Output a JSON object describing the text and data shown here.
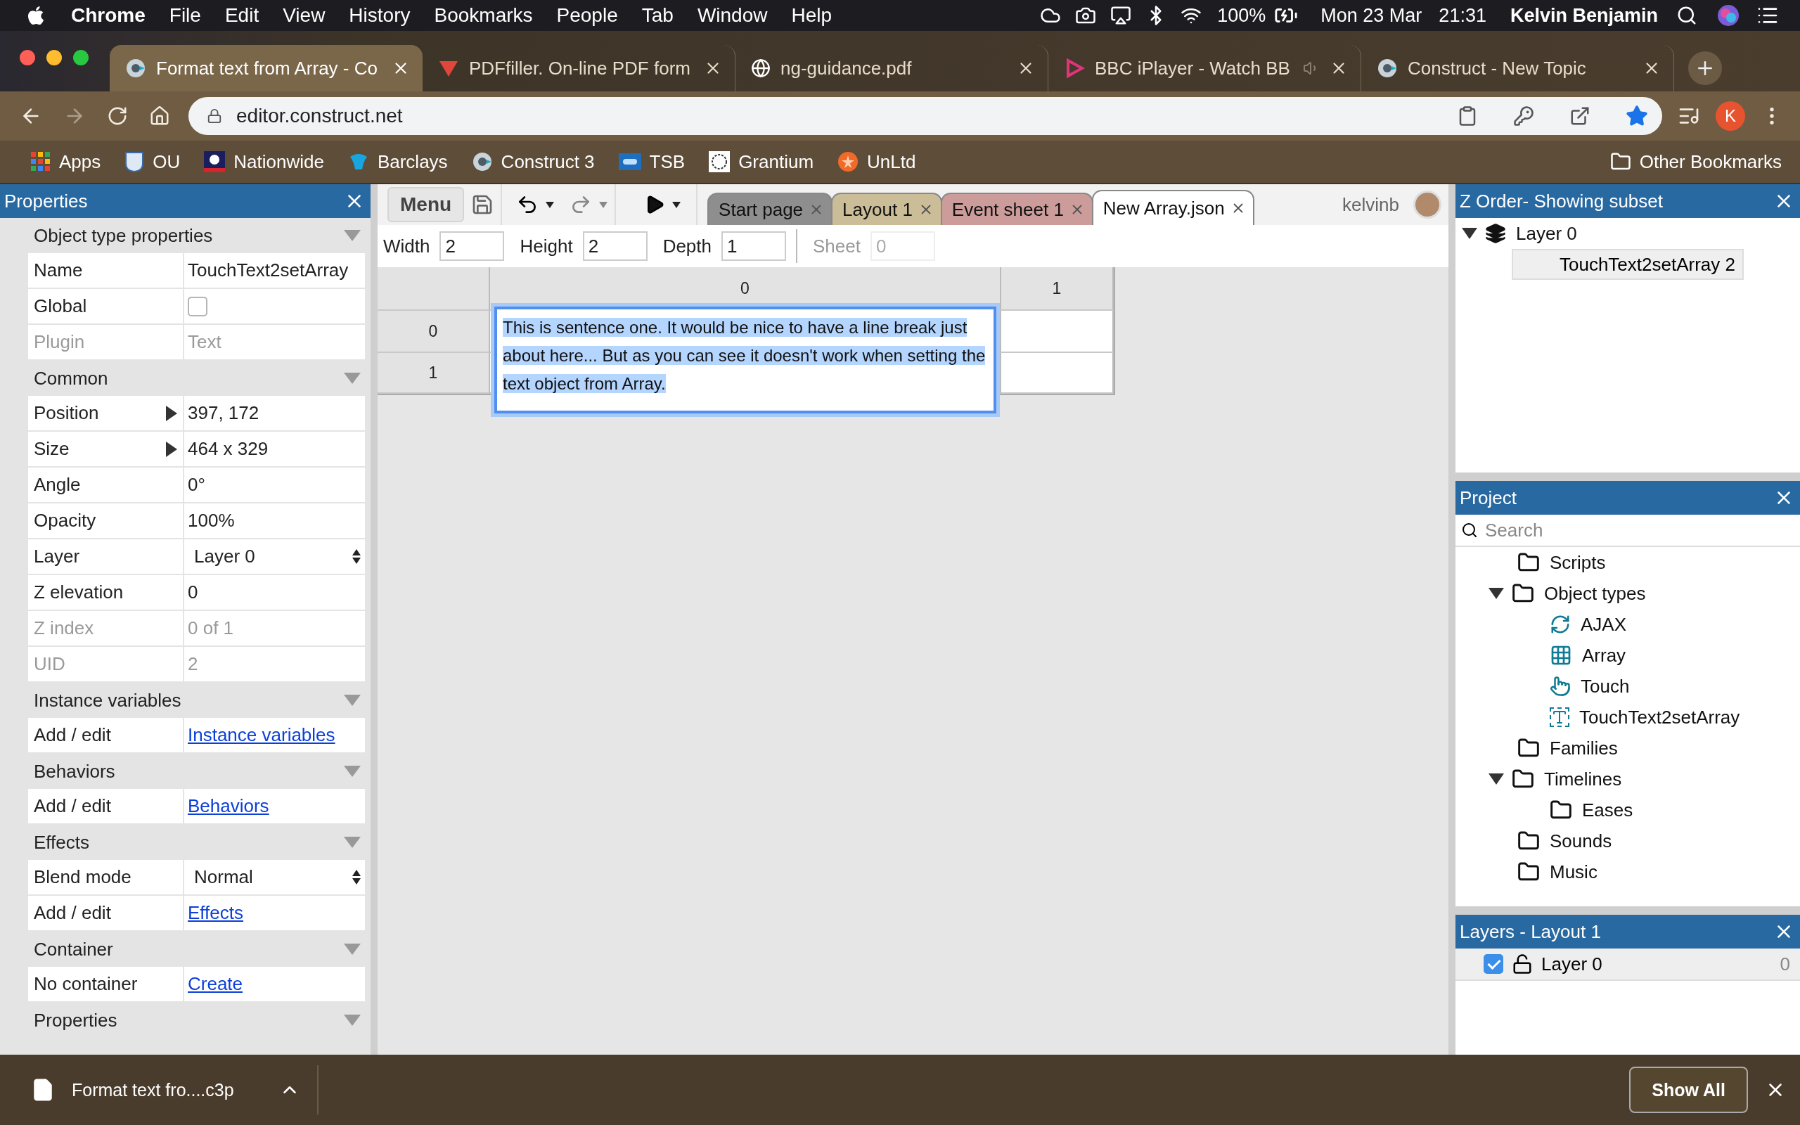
{
  "menubar": {
    "app": "Chrome",
    "menus": [
      "File",
      "Edit",
      "View",
      "History",
      "Bookmarks",
      "People",
      "Tab",
      "Window",
      "Help"
    ],
    "battery": "100%",
    "date": "Mon 23 Mar",
    "time": "21:31",
    "user": "Kelvin Benjamin"
  },
  "browser_tabs": [
    {
      "title": "Format text from Array - Co",
      "selected": true,
      "audio": false
    },
    {
      "title": "PDFfiller. On-line PDF form",
      "selected": false,
      "audio": false
    },
    {
      "title": "ng-guidance.pdf",
      "selected": false,
      "audio": false
    },
    {
      "title": "BBC iPlayer - Watch BB",
      "selected": false,
      "audio": true
    },
    {
      "title": "Construct - New Topic",
      "selected": false,
      "audio": false
    }
  ],
  "address_bar": {
    "url": "editor.construct.net",
    "bookmarked": true
  },
  "profile_initial": "K",
  "bookmarks": [
    "Apps",
    "OU",
    "Nationwide",
    "Barclays",
    "Construct 3",
    "TSB",
    "Grantium",
    "UnLtd"
  ],
  "other_bookmarks": "Other Bookmarks",
  "properties": {
    "title": "Properties",
    "sections": [
      {
        "title": "Object type properties",
        "rows": [
          {
            "kind": "text",
            "label": "Name",
            "value": "TouchText2setArray",
            "disabled": false
          },
          {
            "kind": "checkbox",
            "label": "Global",
            "checked": false
          },
          {
            "kind": "text",
            "label": "Plugin",
            "value": "Text",
            "disabled": true
          }
        ]
      },
      {
        "title": "Common",
        "rows": [
          {
            "kind": "expand",
            "label": "Position",
            "value": "397, 172",
            "expanded": false,
            "disabled": false
          },
          {
            "kind": "expand",
            "label": "Size",
            "value": "464 x 329",
            "expanded": false,
            "disabled": false
          },
          {
            "kind": "text",
            "label": "Angle",
            "value": "0°",
            "disabled": false
          },
          {
            "kind": "text",
            "label": "Opacity",
            "value": "100%",
            "disabled": false
          },
          {
            "kind": "select",
            "label": "Layer",
            "value": "Layer 0"
          },
          {
            "kind": "text",
            "label": "Z elevation",
            "value": "0",
            "disabled": false
          },
          {
            "kind": "text",
            "label": "Z index",
            "value": "0 of 1",
            "disabled": true
          },
          {
            "kind": "text",
            "label": "UID",
            "value": "2",
            "disabled": true
          }
        ]
      },
      {
        "title": "Instance variables",
        "rows": [
          {
            "kind": "link",
            "label": "Add / edit",
            "value": "Instance variables"
          }
        ]
      },
      {
        "title": "Behaviors",
        "rows": [
          {
            "kind": "link",
            "label": "Add / edit",
            "value": "Behaviors"
          }
        ]
      },
      {
        "title": "Effects",
        "rows": [
          {
            "kind": "select",
            "label": "Blend mode",
            "value": "Normal"
          },
          {
            "kind": "link",
            "label": "Add / edit",
            "value": "Effects"
          }
        ]
      },
      {
        "title": "Container",
        "rows": [
          {
            "kind": "link",
            "label": "No container",
            "value": "Create"
          }
        ]
      },
      {
        "title": "Properties"
      }
    ]
  },
  "editor": {
    "menu": "Menu",
    "user": "kelvinb",
    "tabs": [
      {
        "label": "Start page",
        "color": "#8e8e8e",
        "selected": false
      },
      {
        "label": "Layout 1",
        "color": "#cbbd97",
        "selected": false
      },
      {
        "label": "Event sheet 1",
        "color": "#cc9c9a",
        "selected": false
      },
      {
        "label": "New Array.json",
        "color": "#ffffff",
        "selected": true
      }
    ],
    "fields": [
      {
        "label": "Width",
        "value": "2",
        "disabled": false
      },
      {
        "label": "Height",
        "value": "2",
        "disabled": false
      },
      {
        "label": "Depth",
        "value": "1",
        "disabled": false
      },
      {
        "label": "Sheet",
        "value": "0",
        "disabled": true
      }
    ],
    "grid": {
      "columns": [
        "0",
        "1"
      ],
      "rows": [
        "0",
        "1"
      ]
    },
    "cell_editor": "This is sentence one. It would be nice to have a line break just about here... But as you can see it doesn't work when setting the text object from Array."
  },
  "z_order": {
    "title": "Z Order- Showing subset",
    "layer": "Layer 0",
    "expanded": true,
    "items": [
      "TouchText2setArray 2"
    ]
  },
  "project": {
    "title": "Project",
    "search_placeholder": "Search",
    "tree": [
      {
        "label": "Scripts",
        "kind": "folder"
      },
      {
        "label": "Object types",
        "kind": "folder",
        "expanded": true,
        "children": [
          {
            "label": "AJAX",
            "kind": "ajax"
          },
          {
            "label": "Array",
            "kind": "array"
          },
          {
            "label": "Touch",
            "kind": "touch"
          },
          {
            "label": "TouchText2setArray",
            "kind": "text"
          }
        ]
      },
      {
        "label": "Families",
        "kind": "folder"
      },
      {
        "label": "Timelines",
        "kind": "folder",
        "expanded": true,
        "children": [
          {
            "label": "Eases",
            "kind": "folder"
          }
        ]
      },
      {
        "label": "Sounds",
        "kind": "folder"
      },
      {
        "label": "Music",
        "kind": "folder"
      }
    ]
  },
  "layers": {
    "title": "Layers - Layout 1",
    "items": [
      {
        "name": "Layer 0",
        "checked": true,
        "count": "0"
      }
    ]
  },
  "downloads": {
    "file": "Format text fro....c3p",
    "show_all": "Show All"
  }
}
